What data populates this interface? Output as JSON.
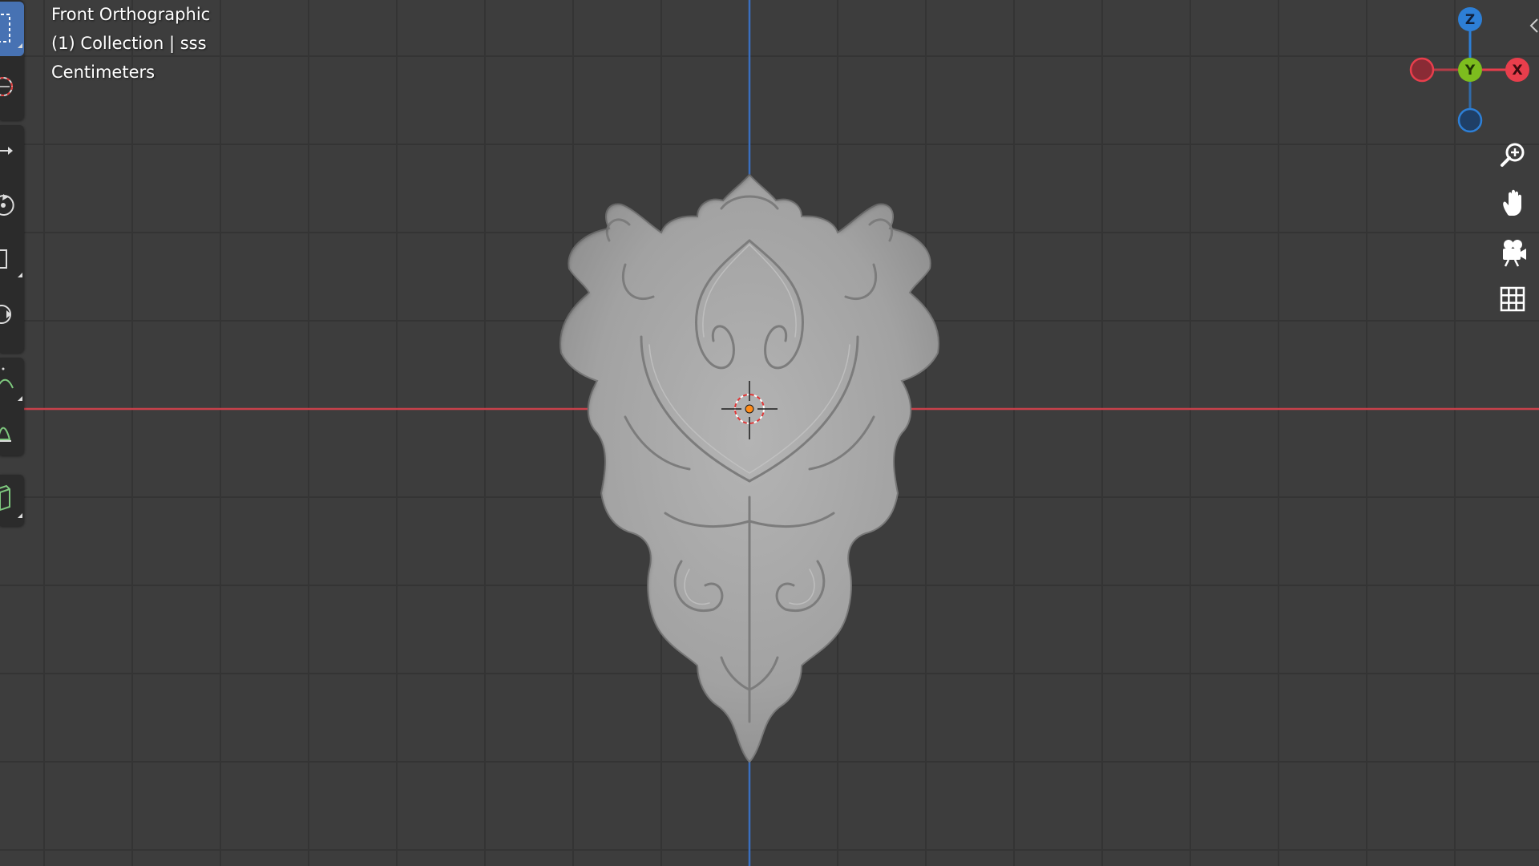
{
  "viewport": {
    "view_name": "Front Orthographic",
    "collection_info": "(1) Collection | sss",
    "units": "Centimeters"
  },
  "gizmo": {
    "z_label": "Z",
    "y_label": "Y",
    "x_label": "X",
    "colors": {
      "x": "#e83e4c",
      "y": "#7dbd1e",
      "z": "#2d7fd6"
    }
  },
  "toolbar": {
    "tools": [
      {
        "name": "select-box",
        "icon": "select-box-icon",
        "active": true
      },
      {
        "name": "cursor",
        "icon": "cursor-icon",
        "active": false
      },
      {
        "name": "move",
        "icon": "move-icon",
        "active": false
      },
      {
        "name": "rotate",
        "icon": "rotate-icon",
        "active": false
      },
      {
        "name": "scale",
        "icon": "scale-icon",
        "active": false
      },
      {
        "name": "transform",
        "icon": "transform-icon",
        "active": false
      },
      {
        "name": "annotate",
        "icon": "annotate-icon",
        "active": false
      },
      {
        "name": "measure",
        "icon": "measure-icon",
        "active": false
      },
      {
        "name": "add-cube",
        "icon": "add-cube-icon",
        "active": false
      }
    ]
  },
  "nav_buttons": {
    "zoom": "zoom-icon",
    "pan": "hand-icon",
    "camera": "camera-icon",
    "ortho": "grid-icon"
  },
  "colors": {
    "background": "#3d3d3d",
    "grid": "#353535",
    "x_axis": "#c8414b",
    "z_axis": "#3a6fbf",
    "model": "#a8a8a8",
    "accent": "#4772b3"
  }
}
